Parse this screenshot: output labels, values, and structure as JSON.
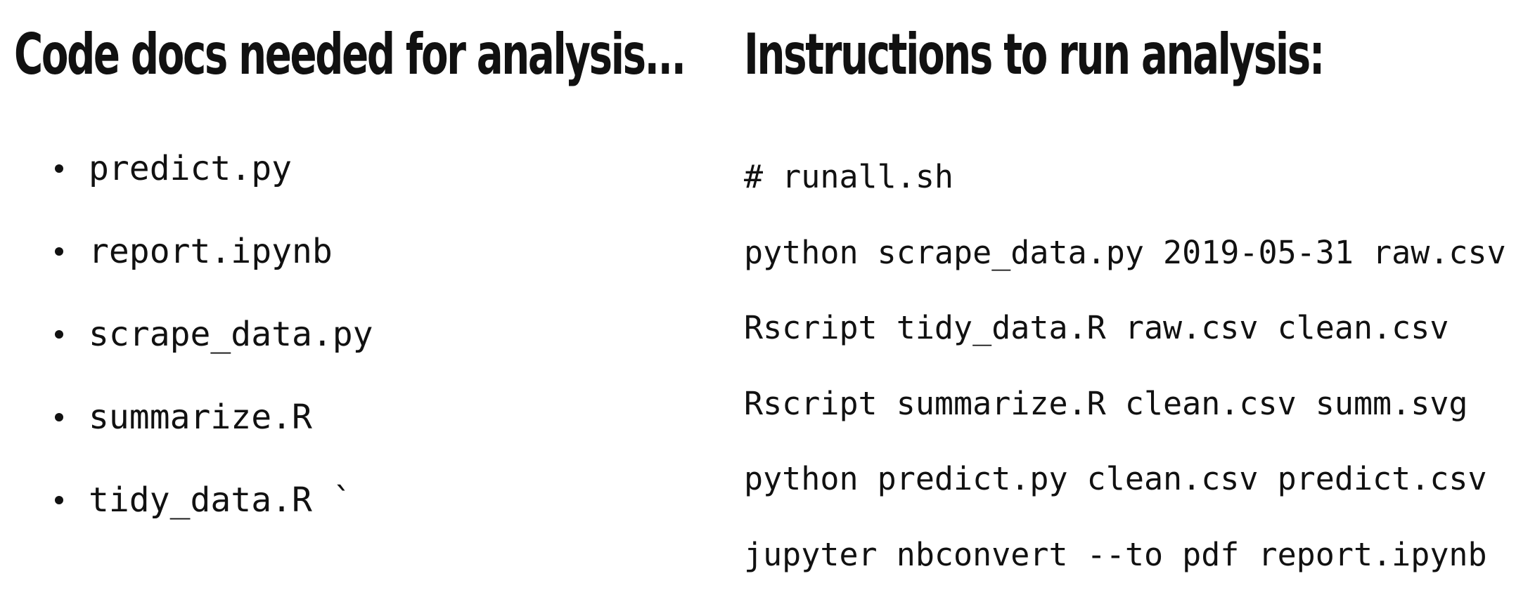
{
  "left": {
    "title": "Code docs needed for analysis...",
    "files": [
      "predict.py",
      "report.ipynb",
      "scrape_data.py",
      "summarize.R",
      "tidy_data.R `"
    ]
  },
  "right": {
    "title": "Instructions to run analysis:",
    "commands": [
      "# runall.sh",
      "python scrape_data.py 2019-05-31 raw.csv",
      "Rscript tidy_data.R raw.csv clean.csv",
      "Rscript summarize.R clean.csv summ.svg",
      "python predict.py clean.csv predict.csv",
      "jupyter nbconvert --to pdf report.ipynb"
    ]
  }
}
